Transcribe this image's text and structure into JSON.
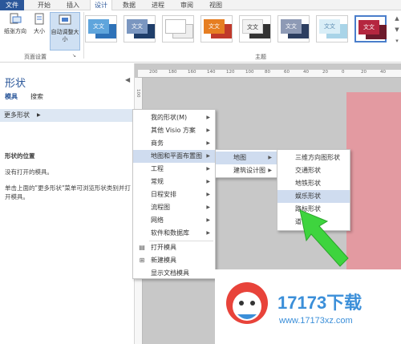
{
  "menubar": {
    "tabs": [
      {
        "label": "文件"
      },
      {
        "label": "开始"
      },
      {
        "label": "插入"
      },
      {
        "label": "设计"
      },
      {
        "label": "数据"
      },
      {
        "label": "进程"
      },
      {
        "label": "审阅"
      },
      {
        "label": "视图"
      }
    ]
  },
  "ribbon": {
    "orientation_label": "纸张方向",
    "size_label": "大小",
    "autofit_label": "自动调整大小",
    "page_setup_group": "页面设置",
    "themes_group": "主题",
    "theme_text": "文文"
  },
  "pane": {
    "title": "形状",
    "tab_models": "模具",
    "tab_search": "搜索",
    "more_shapes": "更多形状",
    "position_heading": "形状的位置",
    "no_open": "没有打开的模具。",
    "instruction": "单击上面的\"更多形状\"菜单可浏览形状类别并打开模具。"
  },
  "ruler": {
    "h_ticks": [
      "200",
      "180",
      "160",
      "140",
      "120",
      "100",
      "80",
      "60",
      "40",
      "20",
      "0",
      "20",
      "40",
      "60",
      "80"
    ],
    "v_ticks": [
      "100"
    ]
  },
  "menu1": {
    "items": [
      {
        "label": "我的形状(M)"
      },
      {
        "label": "其他 Visio 方案"
      },
      {
        "label": "商务"
      },
      {
        "label": "地图和平面布置图"
      },
      {
        "label": "工程"
      },
      {
        "label": "常规"
      },
      {
        "label": "日程安排"
      },
      {
        "label": "流程图"
      },
      {
        "label": "网络"
      },
      {
        "label": "软件和数据库"
      },
      {
        "label": "打开模具"
      },
      {
        "label": "新建模具"
      },
      {
        "label": "显示文档模具"
      }
    ]
  },
  "menu2": {
    "items": [
      {
        "label": "地图"
      },
      {
        "label": "建筑设计图"
      }
    ]
  },
  "menu3": {
    "items": [
      {
        "label": "三维方向图形状"
      },
      {
        "label": "交通形状"
      },
      {
        "label": "地铁形状"
      },
      {
        "label": "娱乐形状"
      },
      {
        "label": "路标形状"
      },
      {
        "label": "道"
      }
    ]
  },
  "watermark": {
    "brand": "17173下载",
    "url": "www.17173xz.com"
  },
  "colors": {
    "accent": "#2b579a",
    "highlight": "#cfdcef",
    "arrow": "#3ed43e",
    "pink": "#e39aa1"
  }
}
